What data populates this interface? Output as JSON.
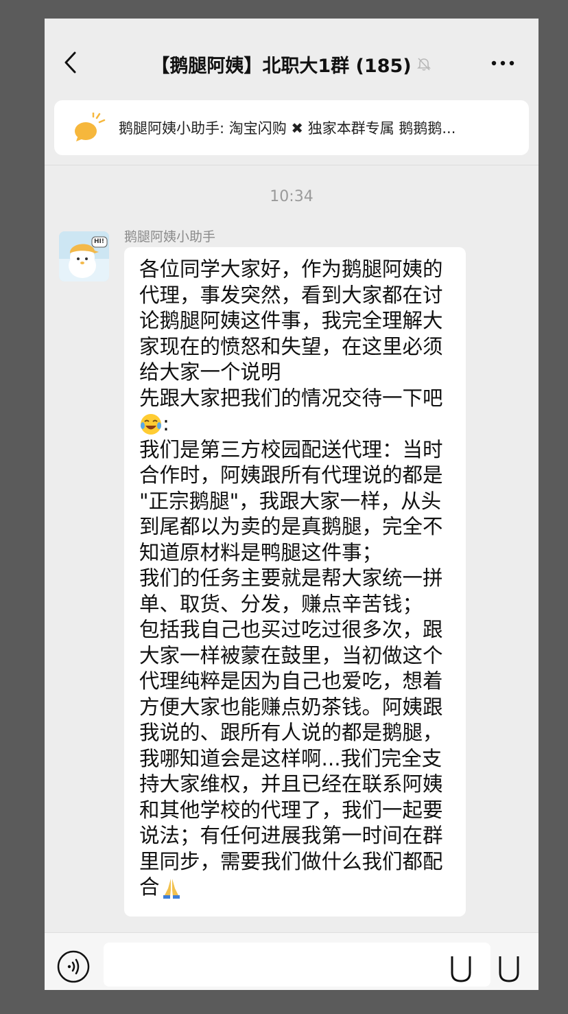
{
  "header": {
    "title": "【鹅腿阿姨】北职大1群 (185)",
    "back_icon": "chevron-left-icon",
    "mute_icon": "bell-muted-icon",
    "more_icon": "more-dots-icon"
  },
  "notice": {
    "icon": "megaphone-icon",
    "text": "鹅腿阿姨小助手: 淘宝闪购 ✖ 独家本群专属 鹅鹅鹅..."
  },
  "chat": {
    "timestamp": "10:34",
    "message": {
      "sender": "鹅腿阿姨小助手",
      "avatar_text": "HI!",
      "lines": [
        "各位同学大家好，作为鹅腿阿姨的",
        "代理，事发突然，看到大家都在讨",
        "论鹅腿阿姨这件事，我完全理解大",
        "家现在的愤怒和失望，在这里必须",
        "给大家一个说明",
        "先跟大家把我们的情况交待一下吧",
        ":",
        "我们是第三方校园配送代理：当时",
        "合作时，阿姨跟所有代理说的都是",
        "\"正宗鹅腿\"，我跟大家一样，从头",
        "到尾都以为卖的是真鹅腿，完全不",
        "知道原材料是鸭腿这件事；",
        "我们的任务主要就是帮大家统一拼",
        "单、取货、分发，赚点辛苦钱；",
        "包括我自己也买过吃过很多次，跟",
        "大家一样被蒙在鼓里，当初做这个",
        "代理纯粹是因为自己也爱吃，想着",
        "方便大家也能赚点奶茶钱。阿姨跟",
        "我说的、跟所有人说的都是鹅腿，",
        "我哪知道会是这样啊...我们完全支",
        "持大家维权，并且已经在联系阿姨",
        "和其他学校的代理了，我们一起要",
        "说法；有任何进展我第一时间在群",
        "里同步，需要我们做什么我们都配",
        "合"
      ],
      "emoji_laugh_cry": "laughing-crying-emoji",
      "emoji_pray": "praying-hands-emoji"
    }
  },
  "input_bar": {
    "voice_icon": "voice-icon",
    "emoji_icon": "emoji-icon",
    "plus_icon": "plus-icon",
    "input_value": ""
  },
  "colors": {
    "chat_background": "#ededed",
    "bubble": "#ffffff",
    "outer_background": "#5b5b5b"
  }
}
